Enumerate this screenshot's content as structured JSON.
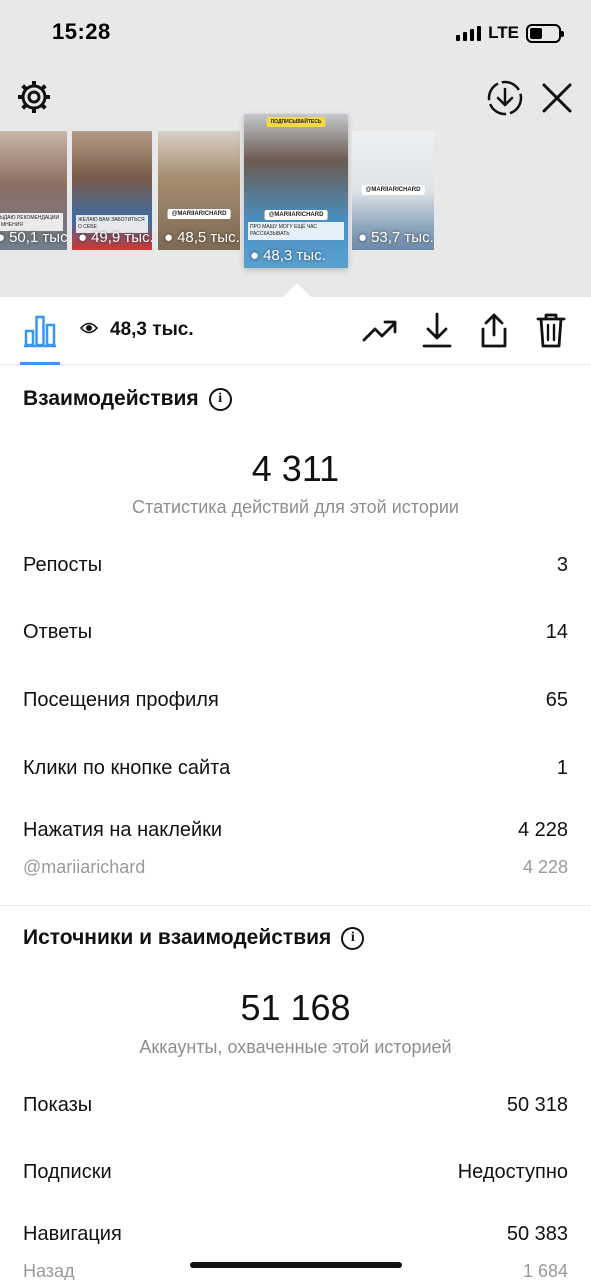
{
  "status_bar": {
    "time": "15:28",
    "network": "LTE"
  },
  "stories": [
    {
      "views": "50,1 тыс.",
      "caption": "ВЫДАЮ РЕКОМЕНДАЦИИ И МНЕНИЯ"
    },
    {
      "views": "49,9 тыс.",
      "caption": "ЖЕЛАЮ ВАМ ЗАБОТИТЬСЯ О СЕБЕ"
    },
    {
      "views": "48,5 тыс.",
      "tag": "@MARIIARICHARD"
    },
    {
      "views": "48,3 тыс.",
      "tag": "@MARIIARICHARD",
      "top_tag": "ПОДПИСЫВАЙТЕСЬ",
      "caption": "ПРО МАШУ МОГУ ЕЩЁ ЧАС РАССКАЗЫВАТЬ"
    },
    {
      "views": "53,7 тыс.",
      "tag": "@MARIIARICHARD"
    }
  ],
  "toolbar": {
    "views_total": "48,3 тыс."
  },
  "interactions": {
    "title": "Взаимодействия",
    "total": "4 311",
    "subtitle": "Статистика действий для этой истории",
    "rows": [
      {
        "label": "Репосты",
        "value": "3"
      },
      {
        "label": "Ответы",
        "value": "14"
      },
      {
        "label": "Посещения профиля",
        "value": "65"
      },
      {
        "label": "Клики по кнопке сайта",
        "value": "1"
      },
      {
        "label": "Нажатия на наклейки",
        "value": "4 228"
      }
    ],
    "sticker_row": {
      "label": "@mariiarichard",
      "value": "4 228"
    }
  },
  "discovery": {
    "title": "Источники и взаимодействия",
    "total": "51 168",
    "subtitle": "Аккаунты, охваченные этой историей",
    "rows": [
      {
        "label": "Показы",
        "value": "50 318"
      },
      {
        "label": "Подписки",
        "value": "Недоступно"
      },
      {
        "label": "Навигация",
        "value": "50 383"
      }
    ],
    "back_row": {
      "label": "Назад",
      "value": "1 684"
    }
  },
  "colors": {
    "accent": "#3897f0",
    "grey_bg": "#e8e8e8",
    "muted": "#8e8e8e"
  }
}
